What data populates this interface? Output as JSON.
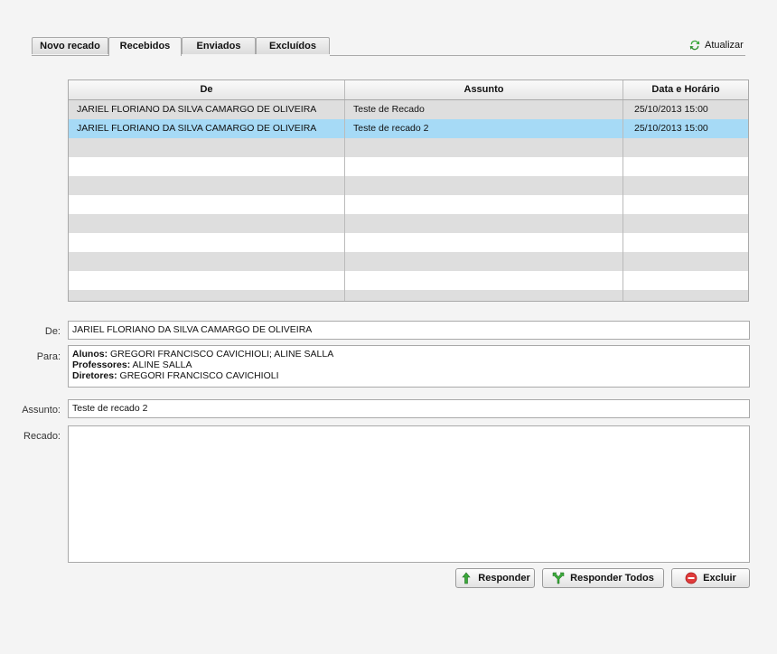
{
  "tabs": [
    {
      "label": "Novo recado",
      "active": false
    },
    {
      "label": "Recebidos",
      "active": true
    },
    {
      "label": "Enviados",
      "active": false
    },
    {
      "label": "Excluídos",
      "active": false
    }
  ],
  "refresh_label": "Atualizar",
  "grid": {
    "columns": [
      "De",
      "Assunto",
      "Data e Horário"
    ],
    "rows": [
      {
        "de": "JARIEL FLORIANO DA SILVA CAMARGO DE OLIVEIRA",
        "assunto": "Teste de Recado",
        "data": "25/10/2013 15:00",
        "selected": false
      },
      {
        "de": "JARIEL FLORIANO DA SILVA CAMARGO DE OLIVEIRA",
        "assunto": "Teste de recado 2",
        "data": "25/10/2013 15:00",
        "selected": true
      }
    ]
  },
  "form": {
    "de_label": "De:",
    "de_value": "JARIEL FLORIANO DA SILVA CAMARGO DE OLIVEIRA",
    "para_label": "Para:",
    "para_lines": [
      {
        "label": "Alunos:",
        "value": "GREGORI FRANCISCO CAVICHIOLI; ALINE SALLA"
      },
      {
        "label": "Professores:",
        "value": " ALINE SALLA"
      },
      {
        "label": "Diretores:",
        "value": "GREGORI FRANCISCO CAVICHIOLI"
      }
    ],
    "assunto_label": "Assunto:",
    "assunto_value": "Teste de recado 2",
    "recado_label": "Recado:",
    "recado_value": ""
  },
  "buttons": {
    "responder": "Responder",
    "responder_todos": "Responder Todos",
    "excluir": "Excluir"
  },
  "colors": {
    "selected_row": "#a6daf6",
    "alt_row": "#dedede",
    "refresh_icon": "#3aa83a",
    "delete_icon": "#e03b3b"
  }
}
